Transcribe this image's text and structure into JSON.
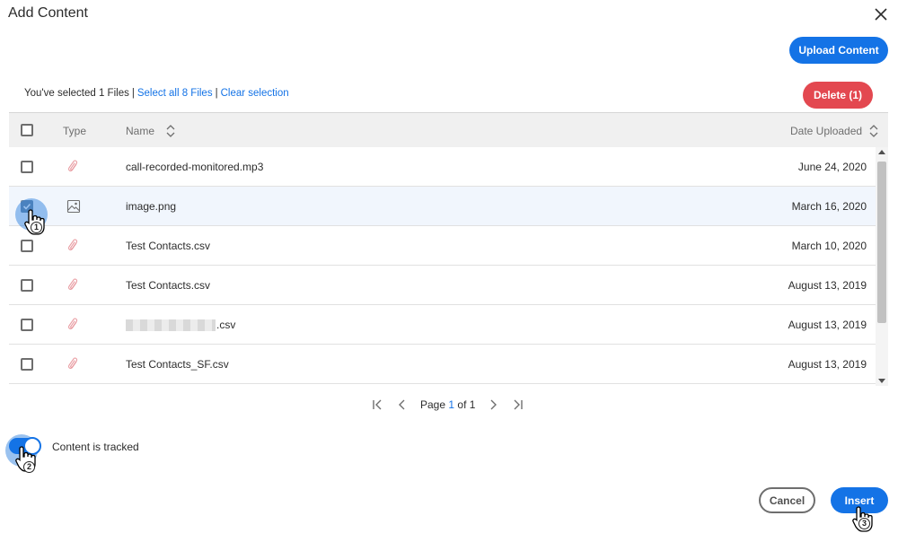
{
  "dialog": {
    "title": "Add Content"
  },
  "toolbar": {
    "upload_label": "Upload Content",
    "delete_label": "Delete (1)"
  },
  "selection": {
    "summary": "You've selected 1 Files",
    "select_all": "Select all 8 Files",
    "clear": "Clear selection"
  },
  "table": {
    "columns": {
      "type": "Type",
      "name": "Name",
      "date": "Date Uploaded"
    },
    "rows": [
      {
        "name": "call-recorded-monitored.mp3",
        "date": "June 24, 2020",
        "icon": "paperclip-icon",
        "selected": false
      },
      {
        "name": "image.png",
        "date": "March 16, 2020",
        "icon": "image-icon",
        "selected": true
      },
      {
        "name": "Test Contacts.csv",
        "date": "March 10, 2020",
        "icon": "paperclip-icon",
        "selected": false
      },
      {
        "name": "Test Contacts.csv",
        "date": "August 13, 2019",
        "icon": "paperclip-icon",
        "selected": false
      },
      {
        "name": ".csv",
        "date": "August 13, 2019",
        "icon": "paperclip-icon",
        "selected": false,
        "redacted": true
      },
      {
        "name": "Test Contacts_SF.csv",
        "date": "August 13, 2019",
        "icon": "paperclip-icon",
        "selected": false
      }
    ]
  },
  "pager": {
    "page_label": "Page",
    "current": "1",
    "of_label": "of",
    "total": "1"
  },
  "tracking": {
    "label": "Content is tracked",
    "on": true
  },
  "footer": {
    "cancel_label": "Cancel",
    "insert_label": "Insert"
  },
  "annotations": {
    "step1": "1",
    "step2": "2",
    "step3": "3"
  },
  "colors": {
    "accent": "#1473e6",
    "danger": "#e34850",
    "attachment_icon": "#e89aa0"
  }
}
